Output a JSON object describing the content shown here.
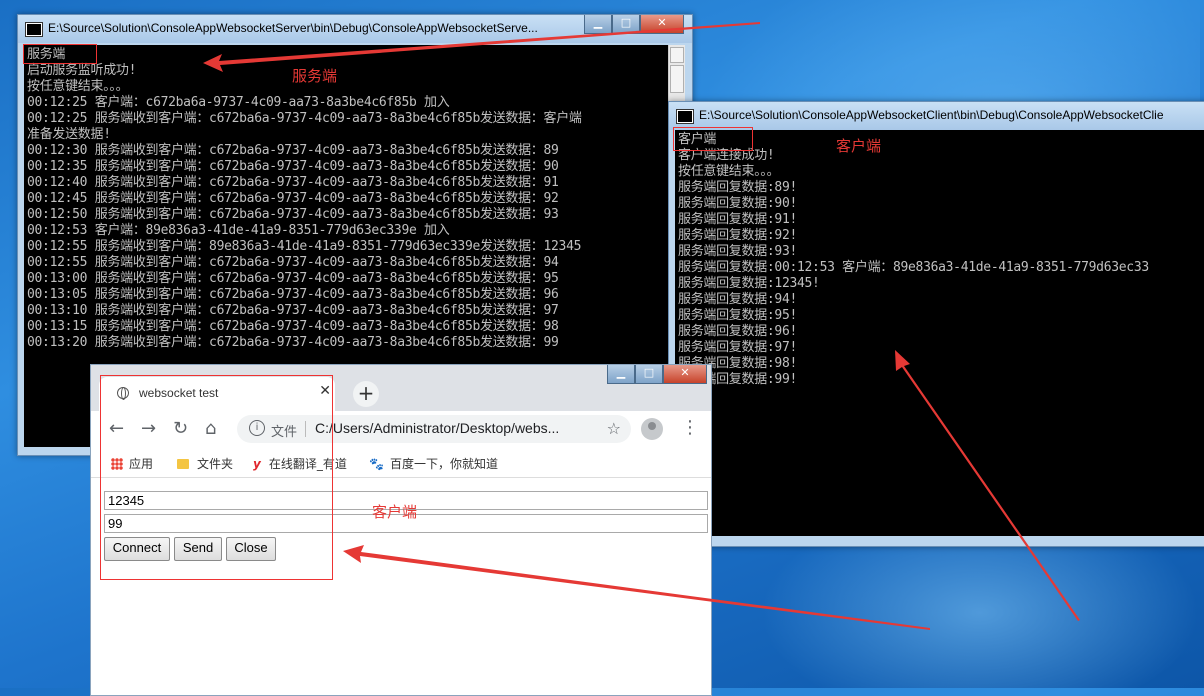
{
  "server_window": {
    "title": "E:\\Source\\Solution\\ConsoleAppWebsocketServer\\bin\\Debug\\ConsoleAppWebsocketServe...",
    "lines": [
      "服务端",
      "启动服务监听成功!",
      "按任意键结束。。。",
      "00:12:25 客户端：c672ba6a-9737-4c09-aa73-8a3be4c6f85b 加入",
      "00:12:25 服务端收到客户端：c672ba6a-9737-4c09-aa73-8a3be4c6f85b发送数据：客户端",
      "准备发送数据!",
      "00:12:30 服务端收到客户端：c672ba6a-9737-4c09-aa73-8a3be4c6f85b发送数据：89",
      "00:12:35 服务端收到客户端：c672ba6a-9737-4c09-aa73-8a3be4c6f85b发送数据：90",
      "00:12:40 服务端收到客户端：c672ba6a-9737-4c09-aa73-8a3be4c6f85b发送数据：91",
      "00:12:45 服务端收到客户端：c672ba6a-9737-4c09-aa73-8a3be4c6f85b发送数据：92",
      "00:12:50 服务端收到客户端：c672ba6a-9737-4c09-aa73-8a3be4c6f85b发送数据：93",
      "00:12:53 客户端：89e836a3-41de-41a9-8351-779d63ec339e 加入",
      "00:12:55 服务端收到客户端：89e836a3-41de-41a9-8351-779d63ec339e发送数据：12345",
      "00:12:55 服务端收到客户端：c672ba6a-9737-4c09-aa73-8a3be4c6f85b发送数据：94",
      "00:13:00 服务端收到客户端：c672ba6a-9737-4c09-aa73-8a3be4c6f85b发送数据：95",
      "00:13:05 服务端收到客户端：c672ba6a-9737-4c09-aa73-8a3be4c6f85b发送数据：96",
      "00:13:10 服务端收到客户端：c672ba6a-9737-4c09-aa73-8a3be4c6f85b发送数据：97",
      "00:13:15 服务端收到客户端：c672ba6a-9737-4c09-aa73-8a3be4c6f85b发送数据：98",
      "00:13:20 服务端收到客户端：c672ba6a-9737-4c09-aa73-8a3be4c6f85b发送数据：99"
    ]
  },
  "client_window": {
    "title": "E:\\Source\\Solution\\ConsoleAppWebsocketClient\\bin\\Debug\\ConsoleAppWebsocketClie",
    "lines": [
      "客户端",
      "客户端连接成功!",
      "按任意键结束。。。",
      "服务端回复数据:89!",
      "服务端回复数据:90!",
      "服务端回复数据:91!",
      "服务端回复数据:92!",
      "服务端回复数据:93!",
      "服务端回复数据:00:12:53 客户端：89e836a3-41de-41a9-8351-779d63ec33",
      "服务端回复数据:12345!",
      "服务端回复数据:94!",
      "服务端回复数据:95!",
      "服务端回复数据:96!",
      "服务端回复数据:97!",
      "服务端回复数据:98!",
      "服务端回复数据:99!"
    ]
  },
  "window_controls": {
    "minimize": "▁",
    "maximize": "□",
    "close": "✕"
  },
  "browser": {
    "tab_title": "websocket test",
    "tab_close": "✕",
    "new_tab": "+",
    "nav": {
      "back": "←",
      "forward": "→",
      "reload": "↻",
      "home": "⌂"
    },
    "address": {
      "info": "i",
      "scheme_label": "文件",
      "url": "C:/Users/Administrator/Desktop/webs...",
      "star": "☆"
    },
    "menu": "⋮",
    "bookmarks": [
      {
        "icon": "apps-icon",
        "label": "应用"
      },
      {
        "icon": "folder-icon",
        "label": "文件夹"
      },
      {
        "icon": "youdao-icon",
        "glyph": "y",
        "label": "在线翻译_有道"
      },
      {
        "icon": "baidu-icon",
        "glyph": "🐾",
        "label": "百度一下，你就知道"
      }
    ],
    "page": {
      "input1_value": "12345",
      "input2_value": "99",
      "buttons": {
        "connect": "Connect",
        "send": "Send",
        "close": "Close"
      }
    }
  },
  "annotations": {
    "server_label": "服务端",
    "client_label_console": "客户端",
    "client_label_browser": "客户端",
    "color": "#e53935"
  }
}
